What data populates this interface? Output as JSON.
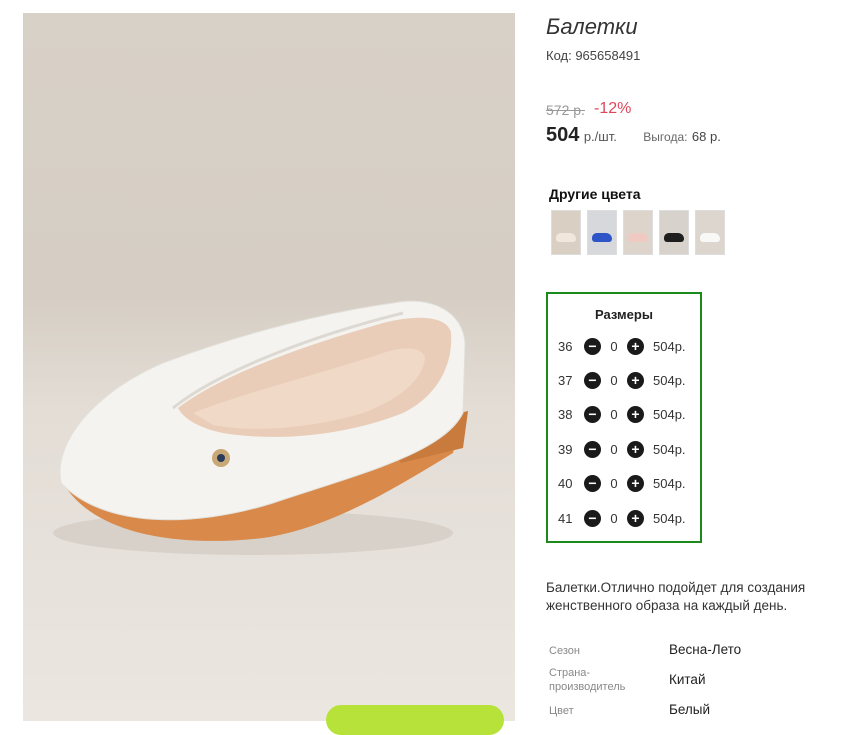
{
  "product": {
    "title": "Балетки",
    "code": "Код: 965658491",
    "old_price": "572 р.",
    "discount": "-12%",
    "price": "504",
    "unit": "р./шт.",
    "save_label": "Выгода:",
    "save_value": "68 р."
  },
  "colors": {
    "title": "Другие цвета",
    "swatches": [
      {
        "name": "beige",
        "bg": "#d9cfc3",
        "shoe": "#f1e7dc"
      },
      {
        "name": "blue",
        "bg": "#d6d8dc",
        "shoe": "#2d55c8"
      },
      {
        "name": "pink",
        "bg": "#ddd5cc",
        "shoe": "#f0c9c2"
      },
      {
        "name": "black",
        "bg": "#d7d2cb",
        "shoe": "#1e1e1e"
      },
      {
        "name": "white",
        "bg": "#dcd6ce",
        "shoe": "#f8f8f6"
      }
    ]
  },
  "sizes": {
    "title": "Размеры",
    "rows": [
      {
        "size": "36",
        "qty": "0",
        "price": "504р."
      },
      {
        "size": "37",
        "qty": "0",
        "price": "504р."
      },
      {
        "size": "38",
        "qty": "0",
        "price": "504р."
      },
      {
        "size": "39",
        "qty": "0",
        "price": "504р."
      },
      {
        "size": "40",
        "qty": "0",
        "price": "504р."
      },
      {
        "size": "41",
        "qty": "0",
        "price": "504р."
      }
    ],
    "minus_symbol": "−",
    "plus_symbol": "+"
  },
  "description": "Балетки.Отлично подойдет для создания женственного образа на каждый день.",
  "specs": [
    {
      "label": "Сезон",
      "value": "Весна-Лето"
    },
    {
      "label": "Страна-производитель",
      "value": "Китай"
    },
    {
      "label": "Цвет",
      "value": "Белый"
    }
  ],
  "accent_colors": {
    "sizes_border": "#1a8a1a",
    "discount": "#e0455a",
    "cart_button": "#b6e23a"
  }
}
